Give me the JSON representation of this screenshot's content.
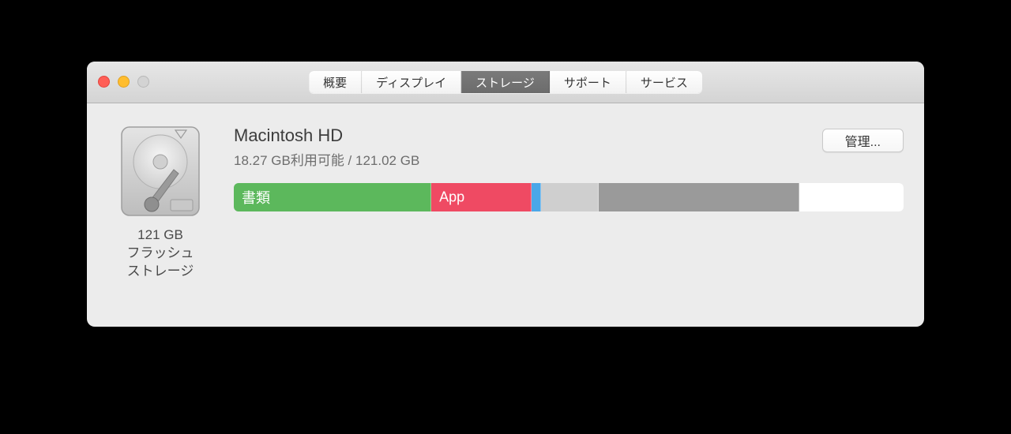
{
  "tabs": {
    "overview": "概要",
    "display": "ディスプレイ",
    "storage": "ストレージ",
    "support": "サポート",
    "service": "サービス"
  },
  "drive": {
    "size_line1": "121 GB",
    "size_line2": "フラッシュ",
    "size_line3": "ストレージ"
  },
  "volume": {
    "name": "Macintosh HD",
    "subtitle": "18.27 GB利用可能 / 121.02 GB",
    "manage_label": "管理..."
  },
  "segments": {
    "docs": {
      "label": "書類",
      "color": "#5cb85c",
      "width": 29.5
    },
    "apps": {
      "label": "App",
      "color": "#ef4a63",
      "width": 15.0
    },
    "blue": {
      "label": "",
      "color": "#4aa7e8",
      "width": 1.4
    },
    "lgray": {
      "label": "",
      "color": "#cfcfcf",
      "width": 8.6
    },
    "dgray": {
      "label": "",
      "color": "#9a9a9a",
      "width": 29.9
    },
    "free": {
      "label": "",
      "color": "#ffffff",
      "width": 15.6
    }
  }
}
